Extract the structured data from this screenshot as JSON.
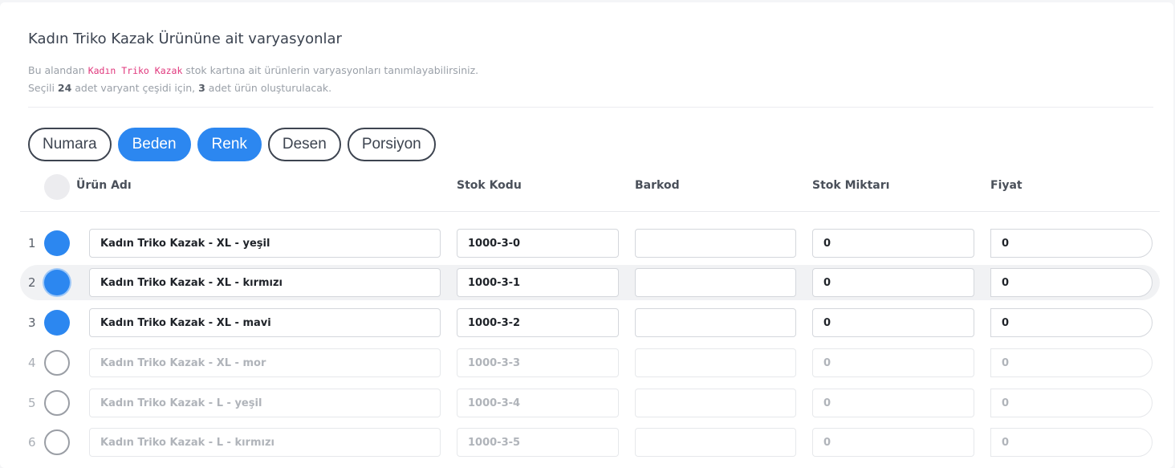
{
  "page": {
    "title": "Kadın Triko Kazak Ürününe ait varyasyonlar",
    "desc_line1_prefix": "Bu alandan ",
    "desc_product": "Kadın Triko Kazak",
    "desc_line1_suffix": " stok kartına ait ürünlerin varyasyonları tanımlayabilirsiniz.",
    "desc_line2_a": "Seçili ",
    "desc_variant_count": "24",
    "desc_line2_b": " adet varyant çeşidi için, ",
    "desc_product_count": "3",
    "desc_line2_c": " adet ürün oluşturulacak."
  },
  "filters": [
    {
      "label": "Numara",
      "active": false
    },
    {
      "label": "Beden",
      "active": true
    },
    {
      "label": "Renk",
      "active": true
    },
    {
      "label": "Desen",
      "active": false
    },
    {
      "label": "Porsiyon",
      "active": false
    }
  ],
  "columns": {
    "name": "Ürün Adı",
    "sku": "Stok Kodu",
    "barcode": "Barkod",
    "stock": "Stok Miktarı",
    "price": "Fiyat"
  },
  "rows": [
    {
      "num": "1",
      "checked": true,
      "name": "Kadın Triko Kazak - XL - yeşil",
      "sku": "1000-3-0",
      "barcode": "",
      "stock": "0",
      "price": "0"
    },
    {
      "num": "2",
      "checked": true,
      "name": "Kadın Triko Kazak - XL - kırmızı",
      "sku": "1000-3-1",
      "barcode": "",
      "stock": "0",
      "price": "0"
    },
    {
      "num": "3",
      "checked": true,
      "name": "Kadın Triko Kazak - XL - mavi",
      "sku": "1000-3-2",
      "barcode": "",
      "stock": "0",
      "price": "0"
    },
    {
      "num": "4",
      "checked": false,
      "name": "Kadın Triko Kazak - XL - mor",
      "sku": "1000-3-3",
      "barcode": "",
      "stock": "0",
      "price": "0"
    },
    {
      "num": "5",
      "checked": false,
      "name": "Kadın Triko Kazak - L - yeşil",
      "sku": "1000-3-4",
      "barcode": "",
      "stock": "0",
      "price": "0"
    },
    {
      "num": "6",
      "checked": false,
      "name": "Kadın Triko Kazak - L - kırmızı",
      "sku": "1000-3-5",
      "barcode": "",
      "stock": "0",
      "price": "0"
    }
  ],
  "colors": {
    "accent": "#2c87f0",
    "highlight": "#e0377c"
  }
}
